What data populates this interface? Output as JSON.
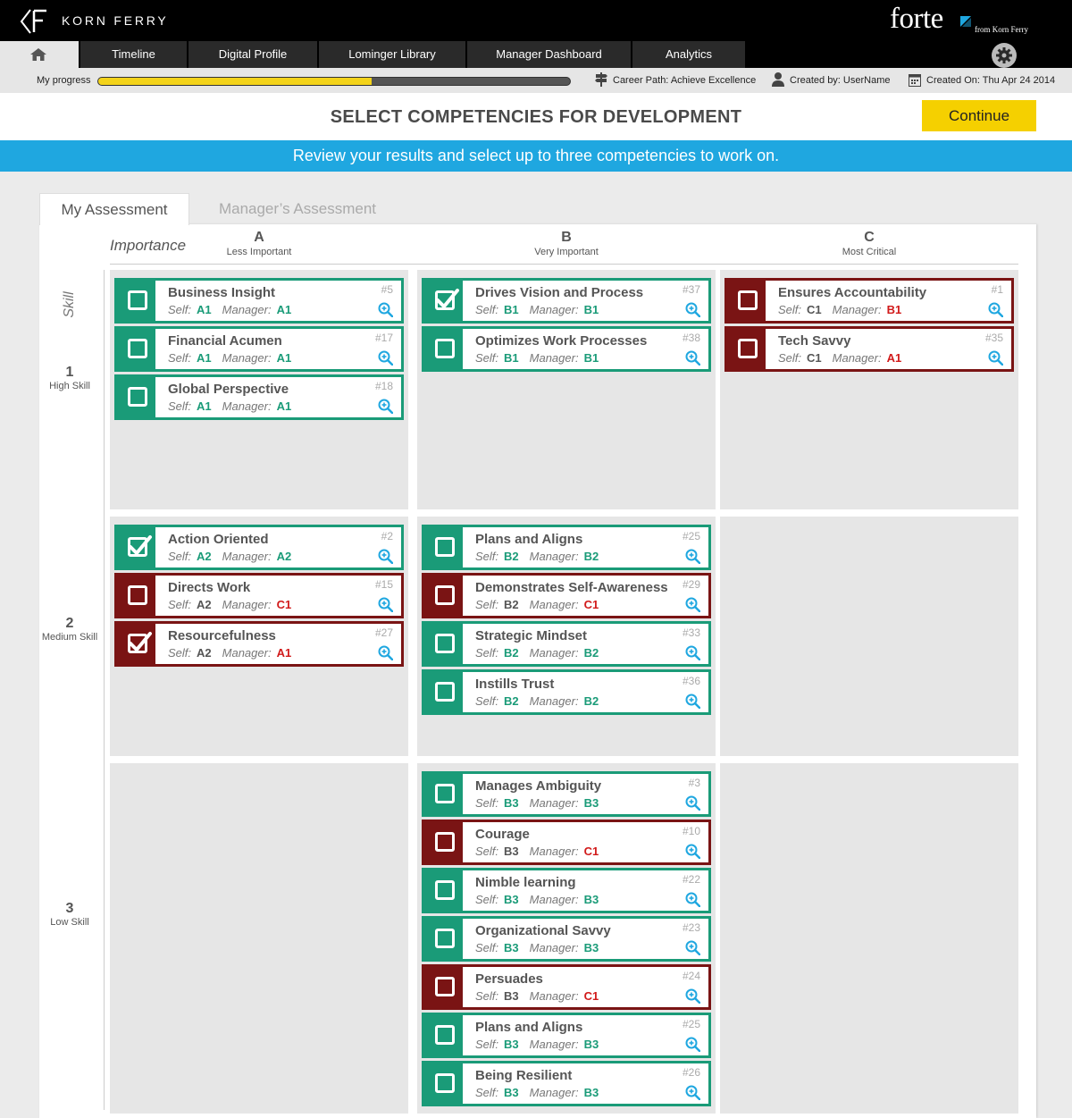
{
  "brand": {
    "company": "KORN FERRY",
    "product": "forte",
    "product_sub": "from Korn Ferry"
  },
  "nav": {
    "home_icon": "home-icon",
    "tabs": [
      "Timeline",
      "Digital Profile",
      "Lominger Library",
      "Manager Dashboard",
      "Analytics"
    ],
    "settings_icon": "gear-icon"
  },
  "progress": {
    "label": "My progress",
    "value": 0.58
  },
  "meta": {
    "career_path": "Career Path: Achieve Excellence",
    "created_by": "Created by: UserName",
    "created_on": "Created On: Thu Apr 24 2014"
  },
  "page": {
    "title": "SELECT COMPETENCIES FOR DEVELOPMENT",
    "continue": "Continue",
    "banner": "Review your results and select up to three competencies to work on."
  },
  "tabs": {
    "my": "My Assessment",
    "manager": "Manager’s Assessment"
  },
  "grid": {
    "importance_label": "Importance",
    "skill_label": "Skill",
    "self_label": "Self:",
    "manager_label": "Manager:",
    "columns": [
      {
        "letter": "A",
        "sub": "Less Important"
      },
      {
        "letter": "B",
        "sub": "Very Important"
      },
      {
        "letter": "C",
        "sub": "Most Critical"
      }
    ],
    "rows": [
      {
        "number": "1",
        "sub": "High Skill"
      },
      {
        "number": "2",
        "sub": "Medium Skill"
      },
      {
        "number": "3",
        "sub": "Low Skill"
      }
    ],
    "colors": {
      "match": "#1a9b78",
      "mismatch": "#7a1414",
      "rating_red": "#d11a1a"
    }
  },
  "cells": [
    {
      "row": 1,
      "col": "A",
      "cards": [
        {
          "name": "Business Insight",
          "num": "#5",
          "self": "A1",
          "manager": "A1",
          "checked": false,
          "mismatch": false
        },
        {
          "name": "Financial Acumen",
          "num": "#17",
          "self": "A1",
          "manager": "A1",
          "checked": false,
          "mismatch": false
        },
        {
          "name": "Global Perspective",
          "num": "#18",
          "self": "A1",
          "manager": "A1",
          "checked": false,
          "mismatch": false
        }
      ]
    },
    {
      "row": 1,
      "col": "B",
      "cards": [
        {
          "name": "Drives Vision and Process",
          "num": "#37",
          "self": "B1",
          "manager": "B1",
          "checked": true,
          "mismatch": false
        },
        {
          "name": "Optimizes Work Processes",
          "num": "#38",
          "self": "B1",
          "manager": "B1",
          "checked": false,
          "mismatch": false
        }
      ]
    },
    {
      "row": 1,
      "col": "C",
      "cards": [
        {
          "name": "Ensures Accountability",
          "num": "#1",
          "self": "C1",
          "manager": "B1",
          "checked": false,
          "mismatch": true
        },
        {
          "name": "Tech Savvy",
          "num": "#35",
          "self": "C1",
          "manager": "A1",
          "checked": false,
          "mismatch": true
        }
      ]
    },
    {
      "row": 2,
      "col": "A",
      "cards": [
        {
          "name": "Action Oriented",
          "num": "#2",
          "self": "A2",
          "manager": "A2",
          "checked": true,
          "mismatch": false
        },
        {
          "name": "Directs Work",
          "num": "#15",
          "self": "A2",
          "manager": "C1",
          "checked": false,
          "mismatch": true
        },
        {
          "name": "Resourcefulness",
          "num": "#27",
          "self": "A2",
          "manager": "A1",
          "checked": true,
          "mismatch": true
        }
      ]
    },
    {
      "row": 2,
      "col": "B",
      "cards": [
        {
          "name": "Plans and Aligns",
          "num": "#25",
          "self": "B2",
          "manager": "B2",
          "checked": false,
          "mismatch": false
        },
        {
          "name": "Demonstrates Self-Awareness",
          "num": "#29",
          "self": "B2",
          "manager": "C1",
          "checked": false,
          "mismatch": true
        },
        {
          "name": "Strategic Mindset",
          "num": "#33",
          "self": "B2",
          "manager": "B2",
          "checked": false,
          "mismatch": false
        },
        {
          "name": "Instills Trust",
          "num": "#36",
          "self": "B2",
          "manager": "B2",
          "checked": false,
          "mismatch": false
        }
      ]
    },
    {
      "row": 2,
      "col": "C",
      "cards": []
    },
    {
      "row": 3,
      "col": "A",
      "cards": []
    },
    {
      "row": 3,
      "col": "B",
      "cards": [
        {
          "name": "Manages Ambiguity",
          "num": "#3",
          "self": "B3",
          "manager": "B3",
          "checked": false,
          "mismatch": false
        },
        {
          "name": "Courage",
          "num": "#10",
          "self": "B3",
          "manager": "C1",
          "checked": false,
          "mismatch": true
        },
        {
          "name": "Nimble learning",
          "num": "#22",
          "self": "B3",
          "manager": "B3",
          "checked": false,
          "mismatch": false
        },
        {
          "name": "Organizational Savvy",
          "num": "#23",
          "self": "B3",
          "manager": "B3",
          "checked": false,
          "mismatch": false
        },
        {
          "name": "Persuades",
          "num": "#24",
          "self": "B3",
          "manager": "C1",
          "checked": false,
          "mismatch": true
        },
        {
          "name": "Plans and Aligns",
          "num": "#25",
          "self": "B3",
          "manager": "B3",
          "checked": false,
          "mismatch": false
        },
        {
          "name": "Being Resilient",
          "num": "#26",
          "self": "B3",
          "manager": "B3",
          "checked": false,
          "mismatch": false
        }
      ]
    },
    {
      "row": 3,
      "col": "C",
      "cards": []
    }
  ]
}
